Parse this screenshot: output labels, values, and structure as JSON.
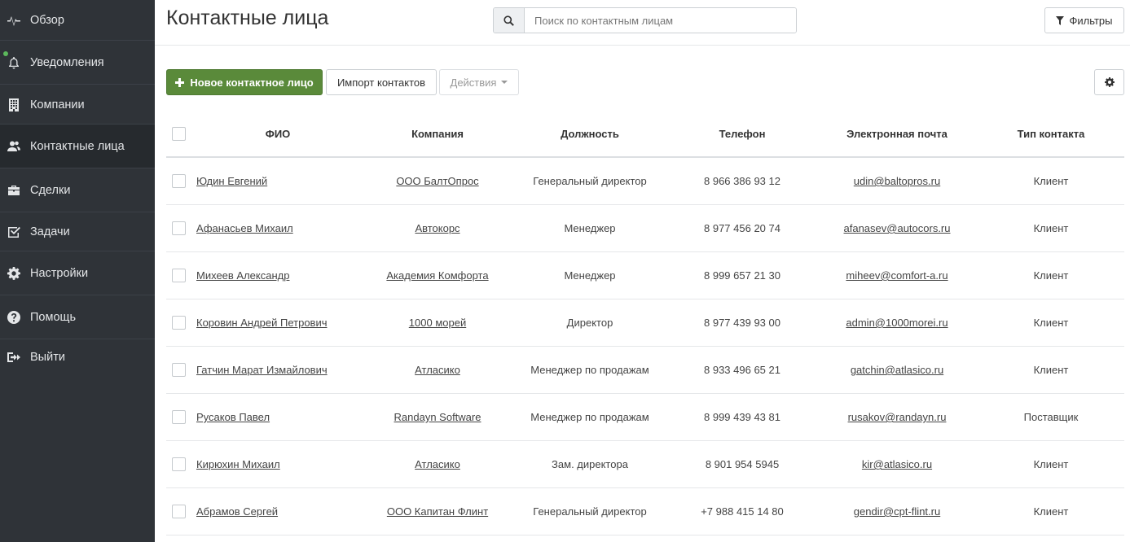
{
  "sidebar": {
    "items": [
      {
        "label": "Обзор",
        "icon": "pulse-icon"
      },
      {
        "label": "Уведомления",
        "icon": "bell-icon"
      },
      {
        "label": "Компании",
        "icon": "building-icon"
      },
      {
        "label": "Контактные лица",
        "icon": "users-icon"
      },
      {
        "label": "Сделки",
        "icon": "briefcase-icon"
      },
      {
        "label": "Задачи",
        "icon": "checkbox-icon"
      },
      {
        "label": "Настройки",
        "icon": "gear-icon"
      },
      {
        "label": "Помощь",
        "icon": "question-icon"
      },
      {
        "label": "Выйти",
        "icon": "sign-out-icon"
      }
    ],
    "active_index": 3
  },
  "header": {
    "title": "Контактные лица",
    "search_placeholder": "Поиск по контактным лицам",
    "filters_label": "Фильтры"
  },
  "toolbar": {
    "new_contact_label": "Новое контактное лицо",
    "import_label": "Импорт контактов",
    "actions_label": "Действия"
  },
  "table": {
    "columns": [
      "ФИО",
      "Компания",
      "Должность",
      "Телефон",
      "Электронная почта",
      "Тип контакта"
    ],
    "rows": [
      {
        "name": "Юдин Евгений",
        "company": "ООО БалтОпрос",
        "position": "Генеральный директор",
        "phone": "8 966 386 93 12",
        "email": "udin@baltopros.ru",
        "type": "Клиент"
      },
      {
        "name": "Афанасьев Михаил",
        "company": "Автокорс",
        "position": "Менеджер",
        "phone": "8 977 456 20 74",
        "email": "afanasev@autocors.ru",
        "type": "Клиент"
      },
      {
        "name": "Михеев Александр",
        "company": "Академия Комфорта",
        "position": "Менеджер",
        "phone": "8 999 657 21 30",
        "email": "miheev@comfort-a.ru",
        "type": "Клиент"
      },
      {
        "name": "Коровин Андрей Петрович",
        "company": "1000 морей",
        "position": "Директор",
        "phone": "8 977 439 93 00",
        "email": "admin@1000morei.ru",
        "type": "Клиент"
      },
      {
        "name": "Гатчин Марат Измайлович",
        "company": "Атласико",
        "position": "Менеджер по продажам",
        "phone": "8 933 496 65 21",
        "email": "gatchin@atlasico.ru",
        "type": "Клиент"
      },
      {
        "name": "Русаков Павел",
        "company": "Randayn Software",
        "position": "Менеджер по продажам",
        "phone": "8 999 439 43 81",
        "email": "rusakov@randayn.ru",
        "type": "Поставщик"
      },
      {
        "name": "Кирюхин Михаил",
        "company": "Атласико",
        "position": "Зам. директора",
        "phone": "8 901 954 5945",
        "email": "kir@atlasico.ru",
        "type": "Клиент"
      },
      {
        "name": "Абрамов Сергей",
        "company": "ООО Капитан Флинт",
        "position": "Генеральный директор",
        "phone": "+7 988 415 14 80",
        "email": "gendir@cpt-flint.ru",
        "type": "Клиент"
      }
    ]
  },
  "colors": {
    "sidebar_bg": "#2f3338",
    "primary_green": "#5a8a3a",
    "notification_dot": "#5cb85c"
  }
}
